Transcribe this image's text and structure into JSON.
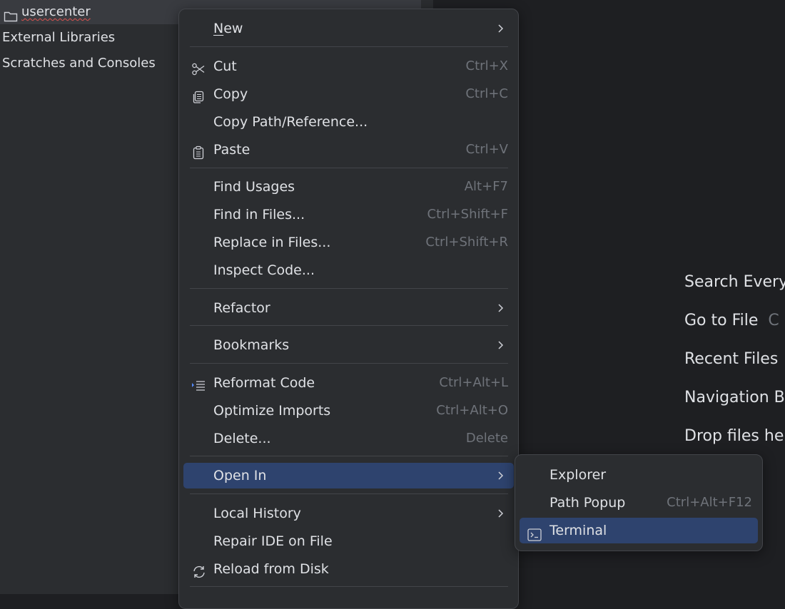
{
  "project_tree": {
    "items": [
      {
        "label": "usercenter",
        "icon": "folder-icon",
        "selected": true,
        "error_underline": true
      },
      {
        "label": "External Libraries"
      },
      {
        "label": "Scratches and Consoles"
      }
    ]
  },
  "editor_hints": [
    {
      "label": "Search Every",
      "shortcut": ""
    },
    {
      "label": "Go to File",
      "shortcut": "C"
    },
    {
      "label": "Recent Files",
      "shortcut": ""
    },
    {
      "label": "Navigation B",
      "shortcut": ""
    },
    {
      "label": "Drop files he",
      "shortcut": ""
    }
  ],
  "context_menu": {
    "new": {
      "label": "New"
    },
    "cut": {
      "label": "Cut",
      "shortcut": "Ctrl+X",
      "icon": "scissors-icon"
    },
    "copy": {
      "label": "Copy",
      "shortcut": "Ctrl+C",
      "icon": "copy-icon"
    },
    "copy_path": {
      "label": "Copy Path/Reference..."
    },
    "paste": {
      "label": "Paste",
      "shortcut": "Ctrl+V",
      "icon": "clipboard-icon"
    },
    "find_usages": {
      "label": "Find Usages",
      "shortcut": "Alt+F7"
    },
    "find_in_files": {
      "label": "Find in Files...",
      "shortcut": "Ctrl+Shift+F"
    },
    "replace_in_files": {
      "label": "Replace in Files...",
      "shortcut": "Ctrl+Shift+R"
    },
    "inspect_code": {
      "label": "Inspect Code..."
    },
    "refactor": {
      "label": "Refactor"
    },
    "bookmarks": {
      "label": "Bookmarks"
    },
    "reformat_code": {
      "label": "Reformat Code",
      "shortcut": "Ctrl+Alt+L",
      "icon": "reformat-icon"
    },
    "optimize_imports": {
      "label": "Optimize Imports",
      "shortcut": "Ctrl+Alt+O"
    },
    "delete": {
      "label": "Delete...",
      "shortcut": "Delete"
    },
    "open_in": {
      "label": "Open In",
      "highlighted": true
    },
    "local_history": {
      "label": "Local History"
    },
    "repair_ide": {
      "label": "Repair IDE on File"
    },
    "reload": {
      "label": "Reload from Disk",
      "icon": "reload-icon"
    }
  },
  "open_in_submenu": {
    "explorer": {
      "label": "Explorer"
    },
    "path_popup": {
      "label": "Path Popup",
      "shortcut": "Ctrl+Alt+F12"
    },
    "terminal": {
      "label": "Terminal",
      "icon": "terminal-icon",
      "highlighted": true
    }
  },
  "colors": {
    "background": "#1e1f22",
    "panel": "#2b2d30",
    "selection": "#2e436e",
    "text": "#dfe1e5",
    "shortcut_text": "#6f737a"
  }
}
